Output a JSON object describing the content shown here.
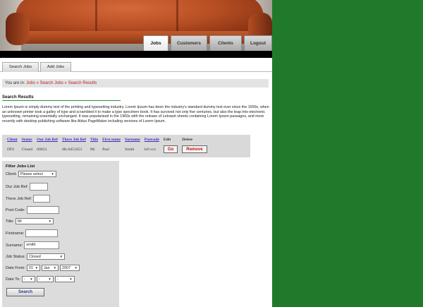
{
  "nav": {
    "tabs": [
      {
        "label": "Jobs",
        "active": true
      },
      {
        "label": "Customers",
        "active": false
      },
      {
        "label": "Clients",
        "active": false
      },
      {
        "label": "Logout",
        "active": false
      }
    ]
  },
  "subnav": {
    "tabs": [
      {
        "label": "Search Jobs"
      },
      {
        "label": "Add Jobs"
      }
    ]
  },
  "breadcrumb": {
    "prefix": "You are in:",
    "items": [
      "Jobs",
      "Search Jobs",
      "Search Results"
    ],
    "separator": "»"
  },
  "section_title": "Search Results",
  "intro": "Lorem Ipsum is simply dummy text of the printing and typesetting industry. Lorem Ipsum has been the industry's standard dummy text ever since the 1500s, when an unknown printer took a galley of type and scrambled it to make a type specimen book. It has survived not only five centuries, but also the leap into electronic typesetting, remaining essentially unchanged. It was popularised in the 1960s with the release of Letraset sheets containing Lorem Ipsum passages, and more recently with desktop publishing software like Aldus PageMaker including versions of Lorem Ipsum.",
  "results": {
    "headers": [
      "Client",
      "Status",
      "Our Job Ref",
      "There Job Ref",
      "Title",
      "First name",
      "Surname",
      "Postcode",
      "Edit",
      "Delete"
    ],
    "rows": [
      {
        "client": "DFS",
        "status": "Closed",
        "our_ref": "00023",
        "their_ref": "dfs-0453453",
        "title": "Mr",
        "first": "Paul",
        "surname": "Smith",
        "postcode": "le9 xxx",
        "edit_label": "Go",
        "delete_label": "Remove"
      }
    ]
  },
  "filter": {
    "title": "Filter Jobs List",
    "client_label": "Client:",
    "client_value": "Please select",
    "our_ref_label": "Our Job Ref:",
    "our_ref_value": "",
    "their_ref_label": "There Job Ref:",
    "their_ref_value": "",
    "postcode_label": "Post Code:",
    "postcode_value": "",
    "title_label": "Title:",
    "title_value": "Mr",
    "firstname_label": "Firstname:",
    "firstname_value": "",
    "surname_label": "Surname:",
    "surname_value": "smith",
    "status_label": "Job Status:",
    "status_value": "Closed",
    "date_from_label": "Date From:",
    "date_from": {
      "day": "01",
      "month": "Jan",
      "year": "2007"
    },
    "date_to_label": "Date To:",
    "date_to": {
      "day": "-",
      "month": "-",
      "year": "-"
    },
    "search_label": "Search"
  }
}
